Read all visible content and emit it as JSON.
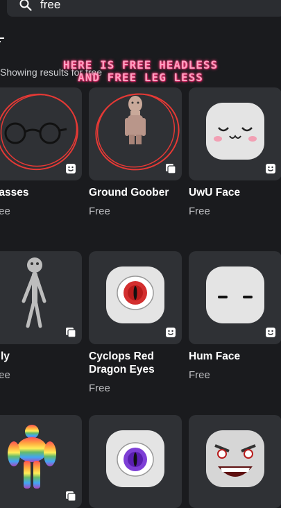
{
  "search": {
    "value": "free"
  },
  "showing_text": "Showing results for free",
  "overlay": {
    "line1": "HERE IS FREE HEADLESS",
    "line2": "AND FREE LEG LESS"
  },
  "items": [
    {
      "name": "Glasses",
      "price": "Free",
      "icon": "glasses-icon"
    },
    {
      "name": "Ground Goober",
      "price": "Free",
      "icon": "ground-goober-avatar"
    },
    {
      "name": "UwU Face",
      "price": "Free",
      "icon": "uwu-face-icon"
    },
    {
      "name": "Silly",
      "price": "Free",
      "icon": "stick-figure-avatar"
    },
    {
      "name": "Cyclops Red Dragon Eyes",
      "price": "Free",
      "icon": "red-dragon-eye-icon"
    },
    {
      "name": "Hum Face",
      "price": "Free",
      "icon": "hum-face-icon"
    },
    {
      "name": "",
      "price": "",
      "icon": "rainbow-muscle-avatar"
    },
    {
      "name": "",
      "price": "",
      "icon": "purple-dragon-eye-icon"
    },
    {
      "name": "",
      "price": "",
      "icon": "angry-face-icon"
    }
  ],
  "colors": {
    "background": "#1a1b1e",
    "card": "#2f3135",
    "overlay": "#ff9fc0",
    "circle": "#e53935"
  }
}
